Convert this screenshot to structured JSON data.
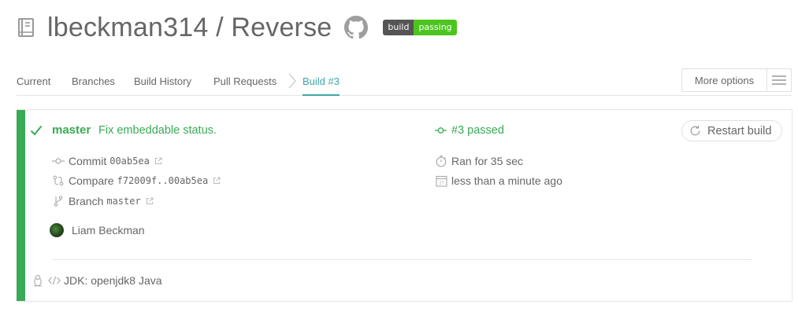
{
  "header": {
    "repo_title": "lbeckman314 / Reverse",
    "badge": {
      "left": "build",
      "right": "passing"
    }
  },
  "tabs": [
    {
      "label": "Current"
    },
    {
      "label": "Branches"
    },
    {
      "label": "Build History"
    },
    {
      "label": "Pull Requests"
    },
    {
      "label": "Build #3"
    }
  ],
  "more_options": {
    "label": "More options"
  },
  "build": {
    "branch": "master",
    "commit_message": "Fix embeddable status.",
    "status": "#3 passed",
    "restart_label": "Restart build",
    "commit": {
      "label": "Commit",
      "value": "00ab5ea"
    },
    "compare": {
      "label": "Compare",
      "value": "f72009f..00ab5ea"
    },
    "branch_meta": {
      "label": "Branch",
      "value": "master"
    },
    "author": "Liam Beckman",
    "duration": "Ran for 35 sec",
    "finished": "less than a minute ago",
    "jdk": "JDK: openjdk8 Java"
  },
  "colors": {
    "passed_green": "#39aa56",
    "accent_teal": "#3fa7a7",
    "text_gray": "#666666",
    "badge_green": "#4cc61e"
  }
}
